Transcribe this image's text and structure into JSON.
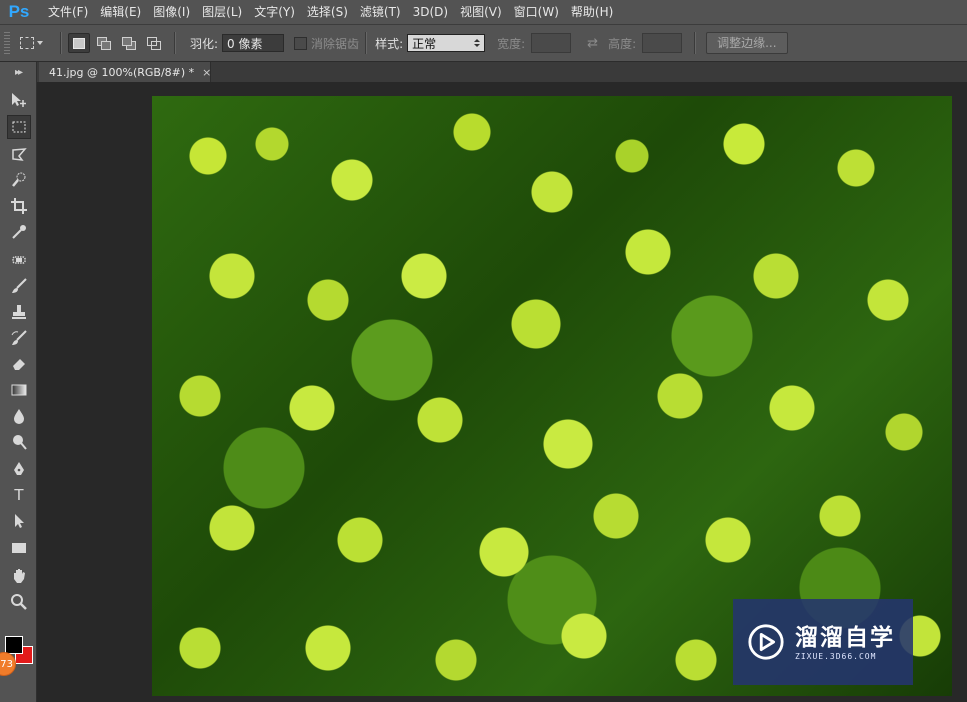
{
  "app": {
    "logo": "Ps",
    "accent_color": "#31a8ff"
  },
  "menu": [
    "文件(F)",
    "编辑(E)",
    "图像(I)",
    "图层(L)",
    "文字(Y)",
    "选择(S)",
    "滤镜(T)",
    "3D(D)",
    "视图(V)",
    "窗口(W)",
    "帮助(H)"
  ],
  "options": {
    "feather_label": "羽化:",
    "feather_value": "0 像素",
    "antialias_label": "消除锯齿",
    "style_label": "样式:",
    "style_value": "正常",
    "width_label": "宽度:",
    "height_label": "高度:",
    "refine_edge_label": "调整边缘..."
  },
  "document": {
    "tab_title": "41.jpg @ 100%(RGB/8#) *",
    "close_glyph": "×"
  },
  "tools": [
    "move-tool",
    "rectangular-marquee-tool",
    "lasso-tool",
    "quick-selection-tool",
    "crop-tool",
    "eyedropper-tool",
    "spot-healing-brush-tool",
    "brush-tool",
    "clone-stamp-tool",
    "history-brush-tool",
    "eraser-tool",
    "gradient-tool",
    "blur-tool",
    "dodge-tool",
    "pen-tool",
    "type-tool",
    "path-selection-tool",
    "rectangle-tool",
    "hand-tool",
    "zoom-tool"
  ],
  "type_tool_glyph": "T",
  "colors": {
    "foreground": "#000000",
    "background": "#e21b1b"
  },
  "badge": {
    "text": "73",
    "color": "#f07c2a"
  },
  "watermark": {
    "name": "溜溜自学",
    "url": "ZIXUE.3D66.COM",
    "color": "#24346e"
  }
}
